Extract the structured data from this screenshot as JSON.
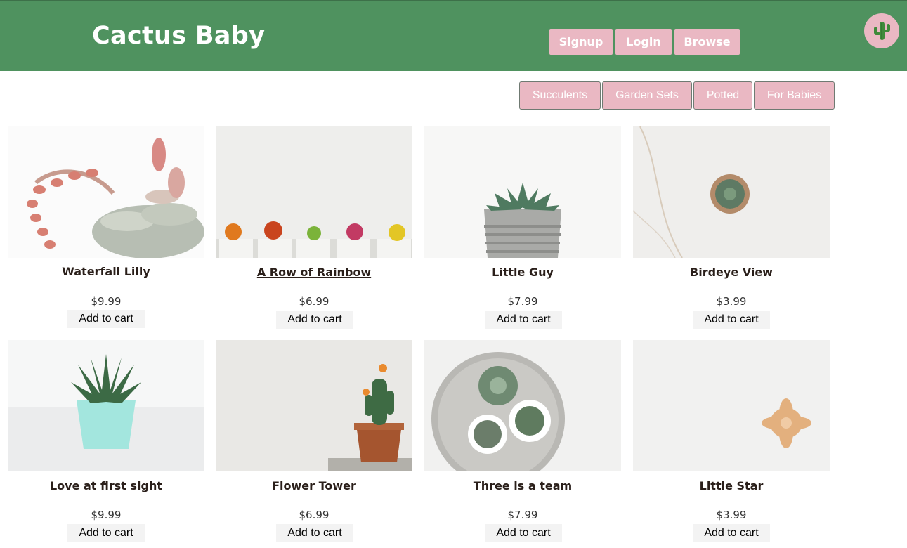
{
  "header": {
    "brand": "Cactus Baby",
    "nav": [
      "Signup",
      "Login",
      "Browse"
    ],
    "avatar_icon": "cactus-icon"
  },
  "categories": [
    "Succulents",
    "Garden Sets",
    "Potted",
    "For Babies"
  ],
  "products": [
    {
      "title": "Waterfall Lilly",
      "price": "$9.99",
      "cart": "Add to cart",
      "image": "pink-succulent"
    },
    {
      "title": "A Row of Rainbow",
      "price": "$6.99",
      "cart": "Add to cart",
      "image": "row-of-cacti"
    },
    {
      "title": "Little Guy",
      "price": "$7.99",
      "cart": "Add to cart",
      "image": "succulent-grey-pot"
    },
    {
      "title": "Birdeye View",
      "price": "$3.99",
      "cart": "Add to cart",
      "image": "cactus-marble"
    },
    {
      "title": "Love at first sight",
      "price": "$9.99",
      "cart": "Add to cart",
      "image": "aloe-mint-pot"
    },
    {
      "title": "Flower Tower",
      "price": "$6.99",
      "cart": "Add to cart",
      "image": "cactus-terracotta"
    },
    {
      "title": "Three is a team",
      "price": "$7.99",
      "cart": "Add to cart",
      "image": "tray-three-plants"
    },
    {
      "title": "Little Star",
      "price": "$3.99",
      "cart": "Add to cart",
      "image": "small-peach-succulent"
    }
  ],
  "colors": {
    "header": "#4f925f",
    "accent": "#eab8c3"
  }
}
